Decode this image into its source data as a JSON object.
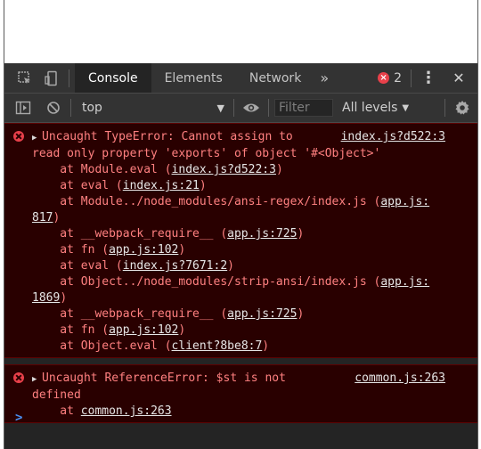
{
  "devtools": {
    "tabs": [
      {
        "label": "Console",
        "active": true
      },
      {
        "label": "Elements",
        "active": false
      },
      {
        "label": "Network",
        "active": false
      }
    ],
    "more_tabs": "»",
    "error_count": "2",
    "error_badge_glyph": "×",
    "kebab_glyph": "⋮",
    "close_glyph": "✕"
  },
  "toolbar": {
    "context": "top",
    "filter_placeholder": "Filter",
    "levels": "All levels",
    "levels_caret": "▼",
    "context_caret": "▼"
  },
  "messages": [
    {
      "source": "index.js?d522:3",
      "line1": "Uncaught TypeError: Cannot assign to",
      "line2": "read only property 'exports' of object '#<Object>'",
      "stack": [
        {
          "prefix": "    at Module.eval (",
          "link": "index.js?d522:3",
          "suffix": ")"
        },
        {
          "prefix": "    at eval (",
          "link": "index.js:21",
          "suffix": ")"
        },
        {
          "prefix": "    at Module../node_modules/ansi-regex/index.js (",
          "link": "app.js:",
          "suffix": ""
        },
        {
          "prefix": "",
          "link": "817",
          "suffix": ")",
          "wrap": true
        },
        {
          "prefix": "    at __webpack_require__ (",
          "link": "app.js:725",
          "suffix": ")"
        },
        {
          "prefix": "    at fn (",
          "link": "app.js:102",
          "suffix": ")"
        },
        {
          "prefix": "    at eval (",
          "link": "index.js?7671:2",
          "suffix": ")"
        },
        {
          "prefix": "    at Object../node_modules/strip-ansi/index.js (",
          "link": "app.js:",
          "suffix": ""
        },
        {
          "prefix": "",
          "link": "1869",
          "suffix": ")",
          "wrap": true
        },
        {
          "prefix": "    at __webpack_require__ (",
          "link": "app.js:725",
          "suffix": ")"
        },
        {
          "prefix": "    at fn (",
          "link": "app.js:102",
          "suffix": ")"
        },
        {
          "prefix": "    at Object.eval (",
          "link": "client?8be8:7",
          "suffix": ")"
        }
      ]
    },
    {
      "source": "common.js:263",
      "line1": "Uncaught ReferenceError: $st is not",
      "line2": "defined",
      "stack": [
        {
          "prefix": "    at ",
          "link": "common.js:263",
          "suffix": ""
        }
      ]
    }
  ],
  "prompt": ">",
  "icons": [
    "inspect-icon",
    "device-toolbar-icon",
    "error-icon",
    "more-icon",
    "close-icon",
    "sidebar-toggle-icon",
    "clear-console-icon",
    "eye-icon",
    "settings-icon"
  ],
  "colors": {
    "error_bg": "#290000",
    "error_text": "#ff8080",
    "panel_bg": "#242424",
    "toolbar_bg": "#333333",
    "accent_blue": "#4b8ff0",
    "error_red": "#e8404a"
  }
}
